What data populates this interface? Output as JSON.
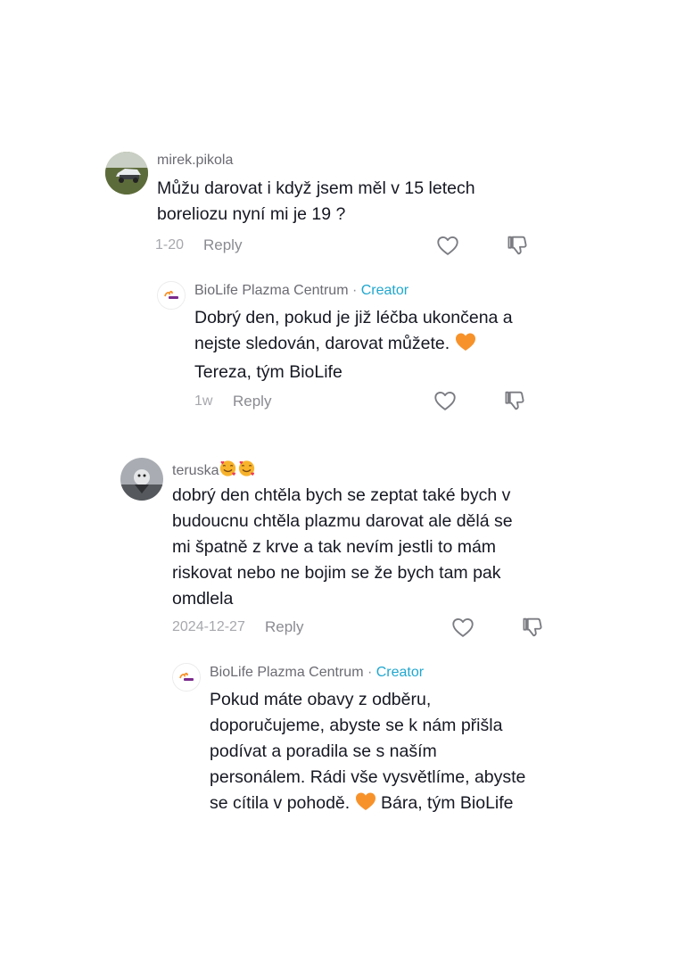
{
  "comments": [
    {
      "username": "mirek.pikola",
      "text_lines": [
        "Můžu darovat i když jsem měl v 15 letech",
        "boreliozu nyní mi je 19 ?"
      ],
      "date": "1-20",
      "reply_label": "Reply",
      "reply": {
        "username": "BioLife Plazma Centrum",
        "separator": "·",
        "creator_label": "Creator",
        "text_lines": [
          "Dobrý den, pokud je již léčba ukončena a",
          "nejste sledován, darovat můžete.",
          "Tereza, tým BioLife"
        ],
        "date": "1w",
        "reply_label": "Reply"
      }
    },
    {
      "username": "teruska",
      "text_lines": [
        "dobrý den chtěla bych se zeptat také bych v",
        "budoucnu chtěla plazmu darovat ale dělá se",
        "mi špatně z krve a tak nevím jestli to mám",
        "riskovat nebo ne bojim se že bych tam pak",
        "omdlela"
      ],
      "date": "2024-12-27",
      "reply_label": "Reply",
      "reply": {
        "username": "BioLife Plazma Centrum",
        "separator": "·",
        "creator_label": "Creator",
        "text_lines": [
          "Pokud máte obavy z odběru,",
          "doporučujeme, abyste se k nám přišla",
          "podívat a poradila se s naším",
          "personálem. Rádi vše vysvětlíme, abyste",
          "se cítila v pohodě."
        ],
        "text_tail": "Bára, tým BioLife"
      }
    }
  ],
  "icons": {
    "like": "heart-outline-icon",
    "dislike": "thumbs-down-icon",
    "heart_emoji": "orange-heart-emoji",
    "smiling_hearts_emoji": "smiling-face-with-hearts-emoji"
  },
  "colors": {
    "creator": "#20a7cf",
    "orange_heart": "#f7922b",
    "meta_gray": "#a7a8ad"
  }
}
